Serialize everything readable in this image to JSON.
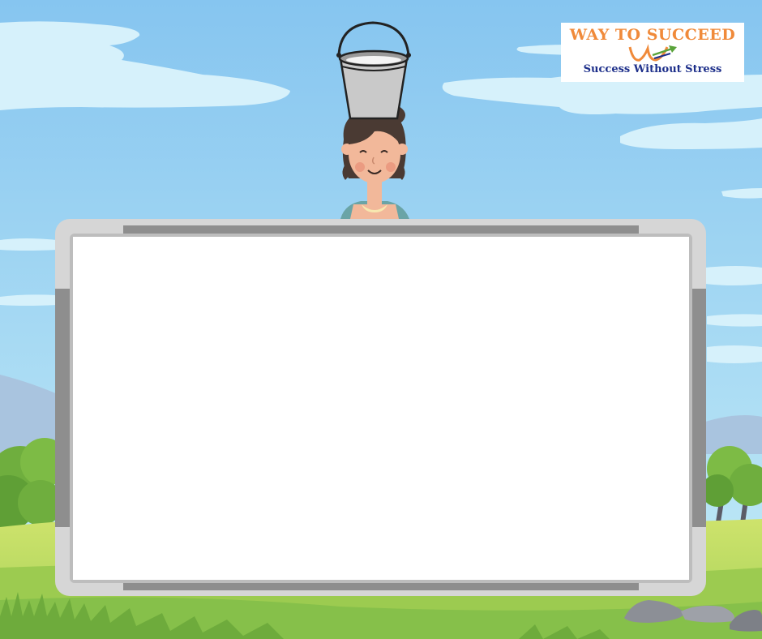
{
  "logo": {
    "title": "WAY TO SUCCEED",
    "tagline": "Success Without Stress"
  },
  "colors": {
    "sky_top": "#86c5f0",
    "sky_bottom": "#c4ecf6",
    "cloud": "#d6f1fb",
    "grass_light": "#cfe36c",
    "grass_mid": "#9ccb50",
    "grass_dark": "#6eab3c",
    "board_frame": "#8e8e8e",
    "board_corner": "#d6d6d6",
    "board_surface": "#ffffff",
    "logo_orange": "#f08a3a",
    "logo_blue": "#1d2f8a"
  },
  "icons": {
    "bucket": "milk-bucket-icon",
    "woman": "woman-character",
    "logo_mark": "w-arrow-logo-icon"
  }
}
